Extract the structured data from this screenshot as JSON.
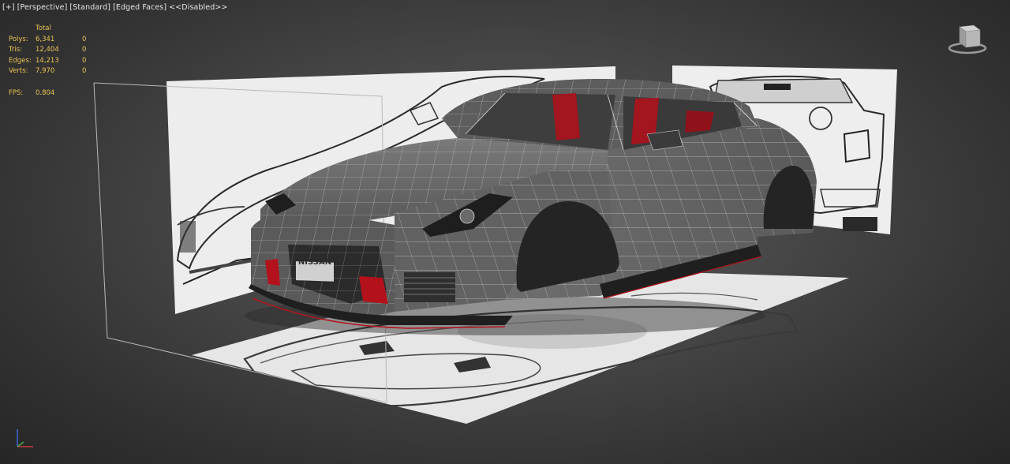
{
  "viewport": {
    "labels": {
      "plus": "[+]",
      "view": "[Perspective]",
      "shading": "[Standard]",
      "edges": "[Edged Faces]",
      "status": "<<Disabled>>"
    }
  },
  "statistics": {
    "header": "Total",
    "rows": [
      {
        "label": "Polys:",
        "total": "6,341",
        "selected": "0"
      },
      {
        "label": "Tris:",
        "total": "12,404",
        "selected": "0"
      },
      {
        "label": "Edges:",
        "total": "14,213",
        "selected": "0"
      },
      {
        "label": "Verts:",
        "total": "7,970",
        "selected": "0"
      }
    ],
    "fps": {
      "label": "FPS:",
      "value": "0.804"
    }
  },
  "scene": {
    "badge_text": "NISSAN",
    "colors": {
      "background": "#3d3d3d",
      "model": "#6a6a6a",
      "wire": "#d8d8d8",
      "accent_red": "#b3121c",
      "stats_text": "#e8c452",
      "blueprint": "#e9e9e9"
    }
  },
  "viewcube": {
    "icon": "viewcube-icon"
  },
  "axis": {
    "icon": "axis-tripod-icon"
  }
}
